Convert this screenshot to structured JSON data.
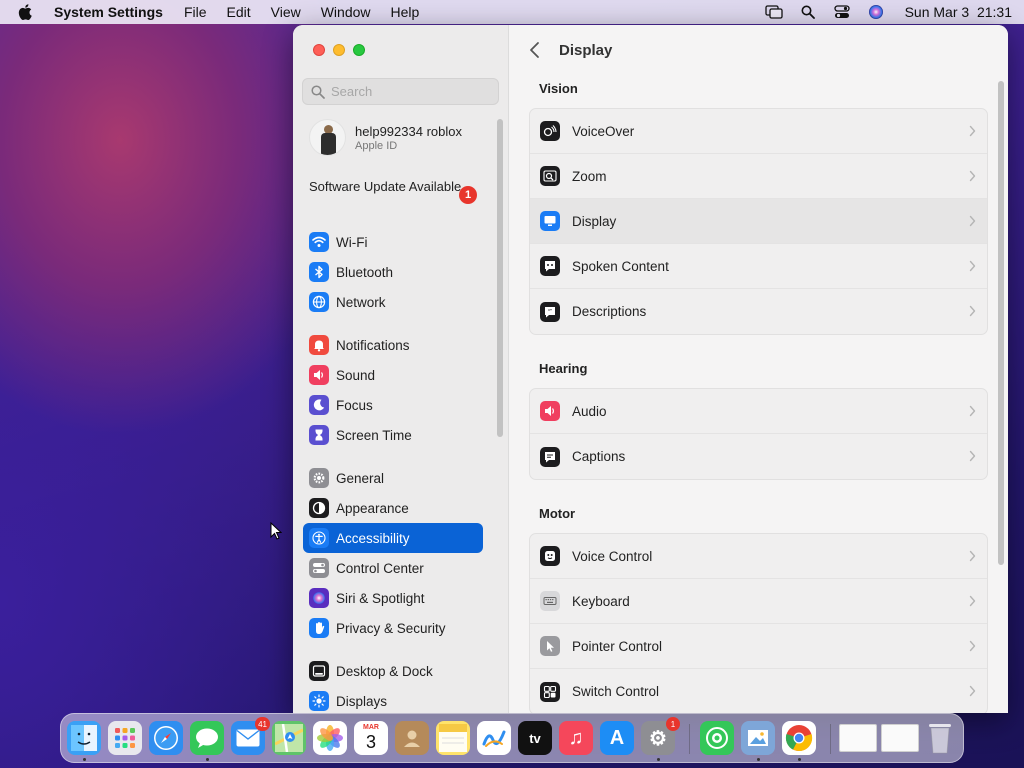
{
  "menubar": {
    "app_name": "System Settings",
    "menus": [
      "File",
      "Edit",
      "View",
      "Window",
      "Help"
    ],
    "date": "Sun Mar 3",
    "time": "21:31"
  },
  "sidebar": {
    "search_placeholder": "Search",
    "apple_id": {
      "name": "help992334 roblox",
      "sub": "Apple ID"
    },
    "software_update": {
      "label": "Software Update Available",
      "badge": "1"
    },
    "items": [
      {
        "label": "Wi-Fi",
        "icon": "wifi-icon",
        "color": "#1a7cf5"
      },
      {
        "label": "Bluetooth",
        "icon": "bluetooth-icon",
        "color": "#1a7cf5"
      },
      {
        "label": "Network",
        "icon": "globe-icon",
        "color": "#1a7cf5"
      },
      {
        "label": "Notifications",
        "icon": "bell-icon",
        "color": "#f04a3e"
      },
      {
        "label": "Sound",
        "icon": "speaker-icon",
        "color": "#f03f5f"
      },
      {
        "label": "Focus",
        "icon": "moon-icon",
        "color": "#5a4fd0"
      },
      {
        "label": "Screen Time",
        "icon": "hourglass-icon",
        "color": "#5a4fd0"
      },
      {
        "label": "General",
        "icon": "gear-icon",
        "color": "#8e8e93"
      },
      {
        "label": "Appearance",
        "icon": "appearance-icon",
        "color": "#1c1c1e"
      },
      {
        "label": "Accessibility",
        "icon": "accessibility-icon",
        "color": "#1a7cf5"
      },
      {
        "label": "Control Center",
        "icon": "toggles-icon",
        "color": "#8e8e93"
      },
      {
        "label": "Siri & Spotlight",
        "icon": "siri-icon",
        "color": "#5a2dbf"
      },
      {
        "label": "Privacy & Security",
        "icon": "hand-icon",
        "color": "#1a7cf5"
      },
      {
        "label": "Desktop & Dock",
        "icon": "dock-icon",
        "color": "#1c1c1e"
      },
      {
        "label": "Displays",
        "icon": "sun-icon",
        "color": "#1a7cf5"
      }
    ]
  },
  "content": {
    "title": "Display",
    "sections": [
      {
        "title": "Vision",
        "rows": [
          "VoiceOver",
          "Zoom",
          "Display",
          "Spoken Content",
          "Descriptions"
        ]
      },
      {
        "title": "Hearing",
        "rows": [
          "Audio",
          "Captions"
        ]
      },
      {
        "title": "Motor",
        "rows": [
          "Voice Control",
          "Keyboard",
          "Pointer Control",
          "Switch Control"
        ]
      }
    ]
  },
  "dock": {
    "apps": [
      {
        "name": "Finder",
        "glyph": ""
      },
      {
        "name": "Launchpad",
        "glyph": ""
      },
      {
        "name": "Safari",
        "glyph": ""
      },
      {
        "name": "Messages",
        "glyph": ""
      },
      {
        "name": "Mail",
        "glyph": "",
        "badge": "41"
      },
      {
        "name": "Maps",
        "glyph": ""
      },
      {
        "name": "Photos",
        "glyph": ""
      },
      {
        "name": "Calendar",
        "glyph": "3",
        "month": "MAR"
      },
      {
        "name": "Contacts",
        "glyph": ""
      },
      {
        "name": "Notes",
        "glyph": ""
      },
      {
        "name": "Freeform",
        "glyph": ""
      },
      {
        "name": "TV",
        "glyph": "tv"
      },
      {
        "name": "Music",
        "glyph": "♫"
      },
      {
        "name": "App Store",
        "glyph": "A"
      },
      {
        "name": "System Settings",
        "glyph": "⚙",
        "badge": "1"
      },
      {
        "name": "Find My",
        "glyph": ""
      },
      {
        "name": "Preview",
        "glyph": ""
      },
      {
        "name": "Chrome",
        "glyph": ""
      }
    ]
  }
}
